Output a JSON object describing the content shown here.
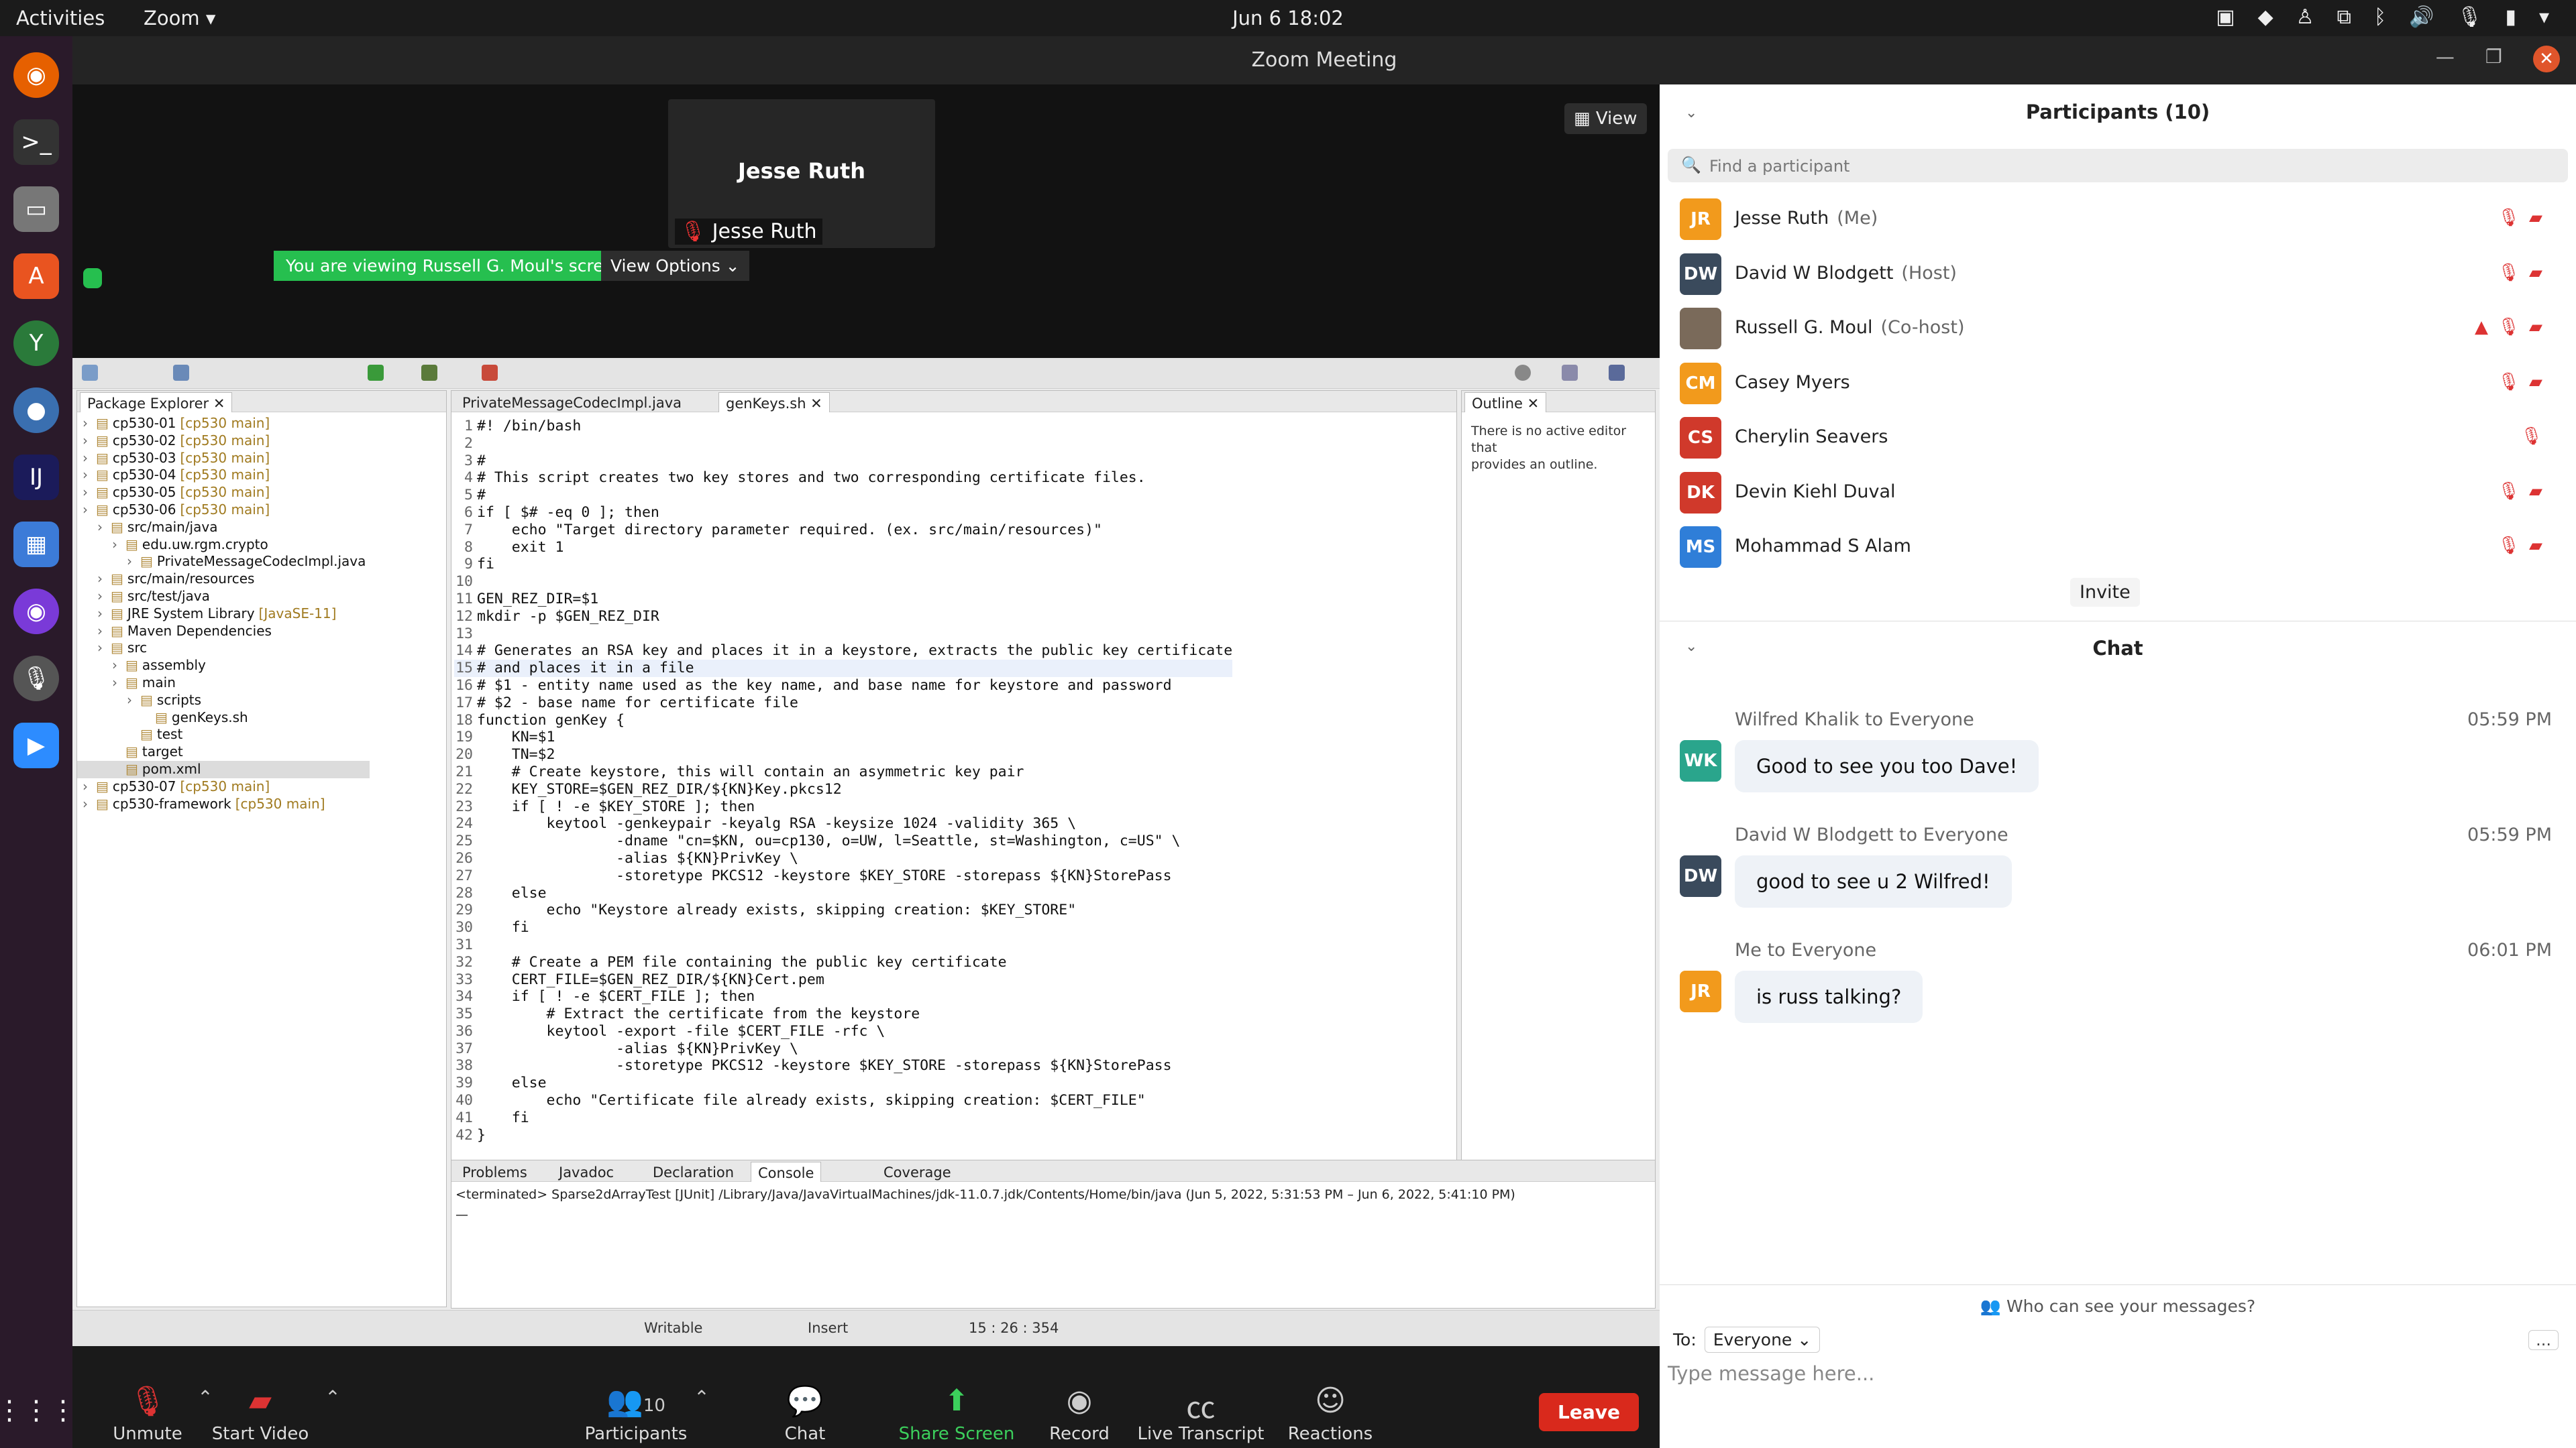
{
  "topbar": {
    "activities": "Activities",
    "app": "Zoom ▾",
    "clock": "Jun 6  18:02"
  },
  "window": {
    "title": "Zoom Meeting"
  },
  "video": {
    "tile_name": "Jesse Ruth",
    "tile_label": "Jesse Ruth",
    "view_btn": "View",
    "viewing_banner": "You are viewing Russell G. Moul's screen",
    "view_options": "View Options ⌄"
  },
  "eclipse": {
    "package_explorer_tab": "Package Explorer",
    "editor_tabs": [
      "PrivateMessageCodecImpl.java",
      "genKeys.sh"
    ],
    "outline_tab": "Outline",
    "outline_msg1": "There is no active editor that",
    "outline_msg2": "provides an outline.",
    "tree": [
      {
        "t": "cp530-01",
        "d": "[cp530 main]"
      },
      {
        "t": "cp530-02",
        "d": "[cp530 main]"
      },
      {
        "t": "cp530-03",
        "d": "[cp530 main]"
      },
      {
        "t": "cp530-04",
        "d": "[cp530 main]"
      },
      {
        "t": "cp530-05",
        "d": "[cp530 main]"
      },
      {
        "t": "cp530-06",
        "d": "[cp530 main]"
      },
      {
        "t": "src/main/java",
        "d": ""
      },
      {
        "t": "edu.uw.rgm.crypto",
        "d": ""
      },
      {
        "t": "PrivateMessageCodecImpl.java",
        "d": ""
      },
      {
        "t": "src/main/resources",
        "d": ""
      },
      {
        "t": "src/test/java",
        "d": ""
      },
      {
        "t": "JRE System Library",
        "d": "[JavaSE-11]"
      },
      {
        "t": "Maven Dependencies",
        "d": ""
      },
      {
        "t": "src",
        "d": ""
      },
      {
        "t": "assembly",
        "d": ""
      },
      {
        "t": "main",
        "d": ""
      },
      {
        "t": "scripts",
        "d": ""
      },
      {
        "t": "genKeys.sh",
        "d": ""
      },
      {
        "t": "test",
        "d": ""
      },
      {
        "t": "target",
        "d": ""
      },
      {
        "t": "pom.xml",
        "d": ""
      },
      {
        "t": "cp530-07",
        "d": "[cp530 main]"
      },
      {
        "t": "cp530-framework",
        "d": "[cp530 main]"
      }
    ],
    "code": [
      "#! /bin/bash",
      "",
      "#",
      "# This script creates two key stores and two corresponding certificate files.",
      "#",
      "if [ $# -eq 0 ]; then",
      "    echo \"Target directory parameter required. (ex. src/main/resources)\"",
      "    exit 1",
      "fi",
      "",
      "GEN_REZ_DIR=$1",
      "mkdir -p $GEN_REZ_DIR",
      "",
      "# Generates an RSA key and places it in a keystore, extracts the public key certificate",
      "# and places it in a file",
      "# $1 - entity name used as the key name, and base name for keystore and password",
      "# $2 - base name for certificate file",
      "function genKey {",
      "    KN=$1",
      "    TN=$2",
      "    # Create keystore, this will contain an asymmetric key pair",
      "    KEY_STORE=$GEN_REZ_DIR/${KN}Key.pkcs12",
      "    if [ ! -e $KEY_STORE ]; then",
      "        keytool -genkeypair -keyalg RSA -keysize 1024 -validity 365 \\",
      "                -dname \"cn=$KN, ou=cp130, o=UW, l=Seattle, st=Washington, c=US\" \\",
      "                -alias ${KN}PrivKey \\",
      "                -storetype PKCS12 -keystore $KEY_STORE -storepass ${KN}StorePass",
      "    else",
      "        echo \"Keystore already exists, skipping creation: $KEY_STORE\"",
      "    fi",
      "",
      "    # Create a PEM file containing the public key certificate",
      "    CERT_FILE=$GEN_REZ_DIR/${KN}Cert.pem",
      "    if [ ! -e $CERT_FILE ]; then",
      "        # Extract the certificate from the keystore",
      "        keytool -export -file $CERT_FILE -rfc \\",
      "                -alias ${KN}PrivKey \\",
      "                -storetype PKCS12 -keystore $KEY_STORE -storepass ${KN}StorePass",
      "    else",
      "        echo \"Certificate file already exists, skipping creation: $CERT_FILE\"",
      "    fi",
      "}"
    ],
    "bottom_tabs": [
      "Problems",
      "Javadoc",
      "Declaration",
      "Console",
      "Coverage"
    ],
    "console_line": "<terminated> Sparse2dArrayTest [JUnit] /Library/Java/JavaVirtualMachines/jdk-11.0.7.jdk/Contents/Home/bin/java  (Jun 5, 2022, 5:31:53 PM – Jun 6, 2022, 5:41:10 PM)",
    "console_out": "—",
    "status": {
      "writable": "Writable",
      "insert": "Insert",
      "pos": "15 : 26 : 354"
    }
  },
  "zoombar": {
    "unmute": "Unmute",
    "start_video": "Start Video",
    "participants": "Participants",
    "participants_count": "10",
    "chat": "Chat",
    "share": "Share Screen",
    "record": "Record",
    "transcript": "Live Transcript",
    "reactions": "Reactions",
    "leave": "Leave"
  },
  "participants": {
    "title": "Participants (10)",
    "search_placeholder": "Find a participant",
    "list": [
      {
        "initials": "JR",
        "name": "Jesse Ruth",
        "role": "(Me)",
        "color": "#f29a1c"
      },
      {
        "initials": "DW",
        "name": "David W Blodgett",
        "role": "(Host)",
        "color": "#3a4a5c"
      },
      {
        "initials": "",
        "name": "Russell G. Moul",
        "role": "(Co-host)",
        "color": "#7a6a5a"
      },
      {
        "initials": "CM",
        "name": "Casey Myers",
        "role": "",
        "color": "#f29a1c"
      },
      {
        "initials": "CS",
        "name": "Cherylin Seavers",
        "role": "",
        "color": "#d0392b"
      },
      {
        "initials": "DK",
        "name": "Devin Kiehl Duval",
        "role": "",
        "color": "#d0392b"
      },
      {
        "initials": "MS",
        "name": "Mohammad S Alam",
        "role": "",
        "color": "#2f7ed8"
      }
    ],
    "invite": "Invite"
  },
  "chat": {
    "title": "Chat",
    "messages": [
      {
        "initials": "WK",
        "color": "#2aa58c",
        "sender": "Wilfred Khalik to Everyone",
        "time": "05:59 PM",
        "text": "Good to see you too Dave!"
      },
      {
        "initials": "DW",
        "color": "#3a4a5c",
        "sender": "David W Blodgett to Everyone",
        "time": "05:59 PM",
        "text": "good to see u 2 Wilfred!"
      },
      {
        "initials": "JR",
        "color": "#f29a1c",
        "sender": "Me to Everyone",
        "time": "06:01 PM",
        "text": "is russ talking?"
      }
    ],
    "who_can_see": "Who can see your messages?",
    "to_label": "To:",
    "to_value": "Everyone ⌄",
    "placeholder": "Type message here...",
    "more": "..."
  }
}
